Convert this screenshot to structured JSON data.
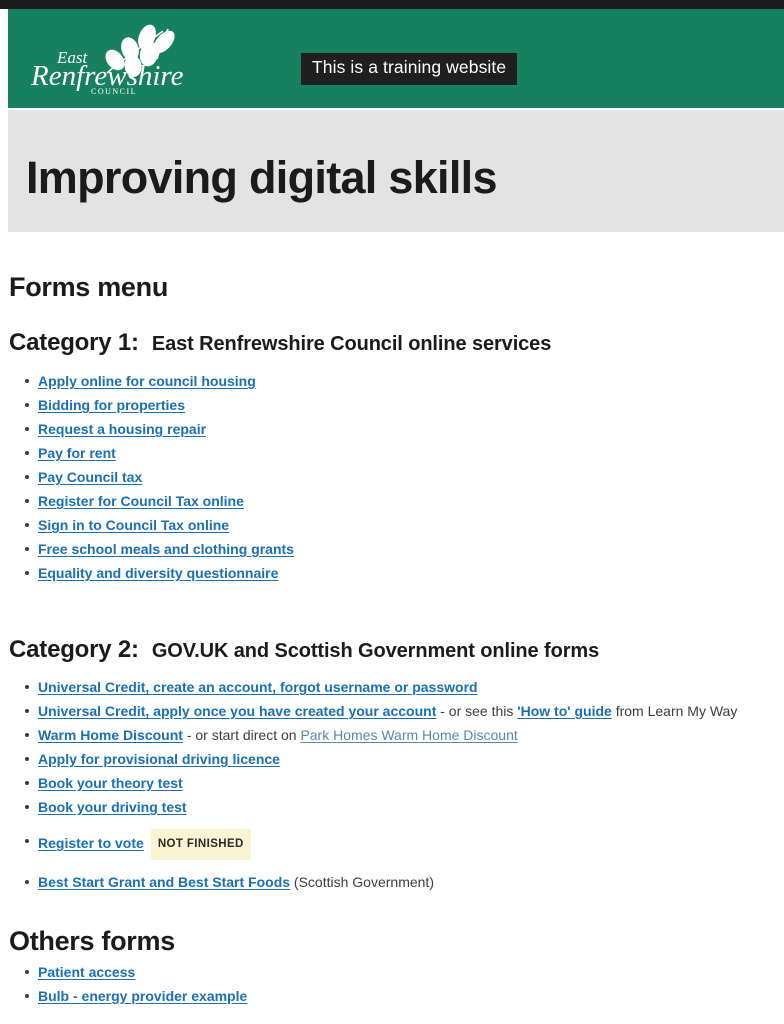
{
  "header": {
    "logo_alt": "East Renfrewshire Council",
    "logo_line1": "East",
    "logo_line2": "Renfrewshire",
    "logo_line3": "COUNCIL",
    "training_banner": "This is a training website",
    "green": "#17805f",
    "banner_bg": "#1f1f1f"
  },
  "title_band": {
    "page_title": "Improving digital skills",
    "background": "#e3e3e3"
  },
  "main": {
    "forms_menu_heading": "Forms menu",
    "others_heading": "Others forms",
    "link_color": "#1a6fb5",
    "badge_color": "#fbf4d2",
    "category1": {
      "label": "Category 1:",
      "description": "East Renfrewshire Council online services",
      "links": [
        {
          "text": "Apply online for council housing"
        },
        {
          "text": "Bidding for properties"
        },
        {
          "text": "Request a housing repair"
        },
        {
          "text": "Pay for rent"
        },
        {
          "text": "Pay Council tax"
        },
        {
          "text": "Register for Council Tax online"
        },
        {
          "text": "Sign in to Council Tax online"
        },
        {
          "text": "Free school meals and clothing grants"
        },
        {
          "text": "Equality and diversity questionnaire"
        }
      ]
    },
    "category2": {
      "label": "Category 2:",
      "description": "GOV.UK and Scottish Government online forms",
      "links": [
        {
          "text": "Universal Credit, create an account, forgot username or password"
        },
        {
          "text": "Universal Credit, apply once you have created your account",
          "mid_text": " - or see this ",
          "second_link": "'How to' guide",
          "tail_text": " from Learn My Way"
        },
        {
          "text": "Warm Home Discount",
          "mid_text": " - or start direct on ",
          "plain_link": "Park Homes Warm Home Discount"
        },
        {
          "text": "Apply for provisional driving licence"
        },
        {
          "text": "Book your theory test"
        },
        {
          "text": "Book your driving test"
        },
        {
          "text": "Register to vote",
          "badge": "NOT FINISHED"
        },
        {
          "text": "Best Start Grant and Best Start Foods",
          "tail_text": " (Scottish Government)"
        }
      ]
    },
    "others": {
      "links": [
        {
          "text": "Patient access"
        },
        {
          "text": "Bulb - energy provider example"
        }
      ]
    }
  }
}
